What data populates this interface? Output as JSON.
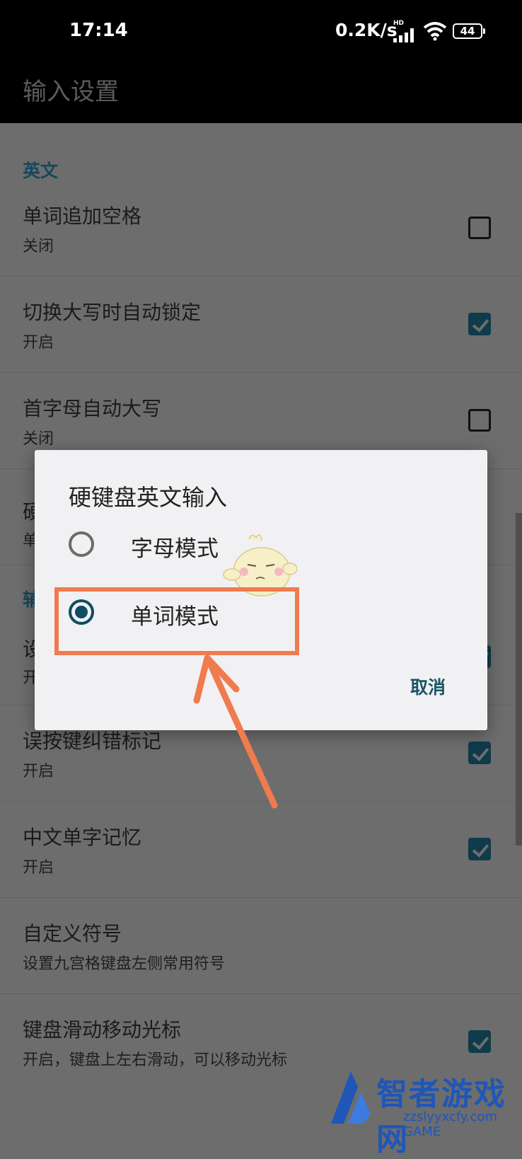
{
  "status_bar": {
    "time": "17:14",
    "network_speed": "0.2K/s",
    "network_type": "HD",
    "battery": "44"
  },
  "app_bar": {
    "title": "输入设置"
  },
  "settings": {
    "section_english": "英文",
    "section_aux": "辅",
    "items": [
      {
        "title": "单词追加空格",
        "subtitle": "关闭",
        "checked": false
      },
      {
        "title": "切换大写时自动锁定",
        "subtitle": "开启",
        "checked": true
      },
      {
        "title": "首字母自动大写",
        "subtitle": "关闭",
        "checked": false
      },
      {
        "title": "硬",
        "subtitle": "单",
        "checked": null
      },
      {
        "title": "设",
        "subtitle": "开",
        "checked": true
      },
      {
        "title": "误按键纠错标记",
        "subtitle": "开启",
        "checked": true
      },
      {
        "title": "中文单字记忆",
        "subtitle": "开启",
        "checked": true
      },
      {
        "title": "自定义符号",
        "subtitle": "设置九宫格键盘左侧常用符号",
        "checked": null
      },
      {
        "title": "键盘滑动移动光标",
        "subtitle": "开启，键盘上左右滑动，可以移动光标",
        "checked": true
      }
    ]
  },
  "dialog": {
    "title": "硬键盘英文输入",
    "options": [
      {
        "label": "字母模式",
        "selected": false
      },
      {
        "label": "单词模式",
        "selected": true
      }
    ],
    "cancel_label": "取消"
  },
  "watermark": {
    "text": "智者游戏网",
    "url": "zzslyyxcfy.com",
    "suffix": "GAME"
  },
  "colors": {
    "accent": "#0e4d63",
    "highlight": "#ef7b4e",
    "scrim": "#6d6d6d",
    "dialog_bg": "#f1f1f3"
  }
}
